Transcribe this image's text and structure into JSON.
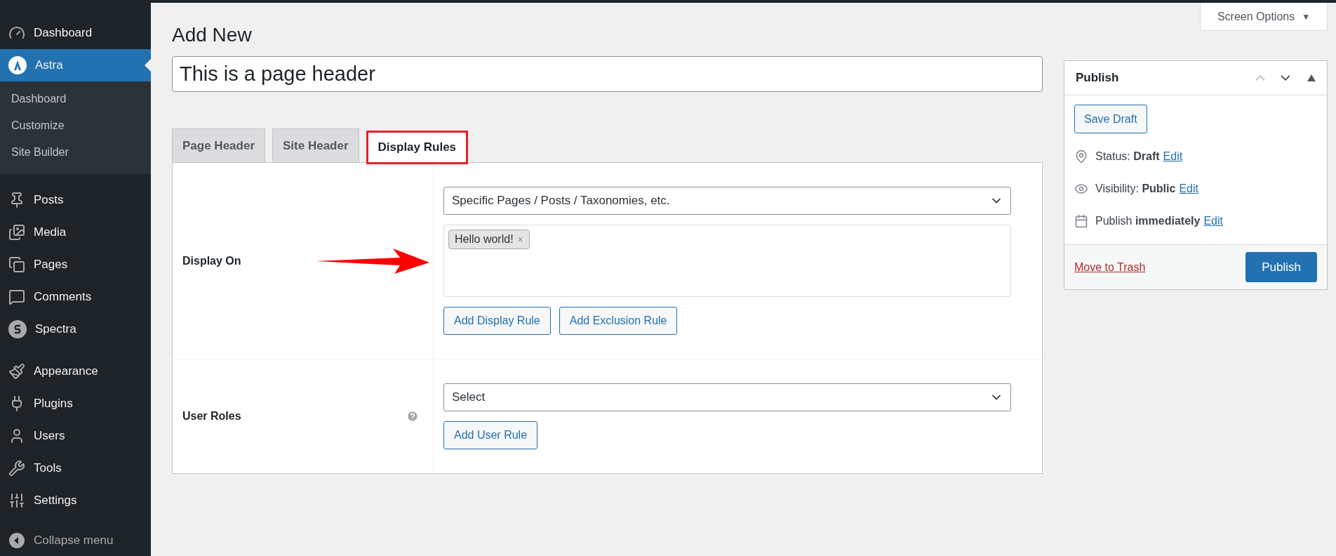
{
  "sidebar": {
    "groups": [
      {
        "items": [
          {
            "label": "Dashboard",
            "selected": false
          },
          {
            "label": "Astra",
            "selected": true,
            "expanded": true,
            "children": [
              {
                "label": "Dashboard"
              },
              {
                "label": "Customize"
              },
              {
                "label": "Site Builder"
              }
            ]
          }
        ]
      },
      {
        "items": [
          {
            "label": "Posts",
            "selected": false
          },
          {
            "label": "Media",
            "selected": false
          },
          {
            "label": "Pages",
            "selected": false
          },
          {
            "label": "Comments",
            "selected": false
          },
          {
            "label": "Spectra",
            "selected": false
          }
        ]
      },
      {
        "items": [
          {
            "label": "Appearance",
            "selected": false
          },
          {
            "label": "Plugins",
            "selected": false
          },
          {
            "label": "Users",
            "selected": false
          },
          {
            "label": "Tools",
            "selected": false
          },
          {
            "label": "Settings",
            "selected": false
          }
        ]
      }
    ],
    "collapse": "Collapse menu"
  },
  "screen_options": {
    "label": "Screen Options",
    "arrow": "▼"
  },
  "page_title": "Add New",
  "title_field": {
    "value": "This is a page header"
  },
  "tabs": [
    {
      "label": "Page Header",
      "selected": false,
      "highlighted": false
    },
    {
      "label": "Site Header",
      "selected": false,
      "highlighted": false
    },
    {
      "label": "Display Rules",
      "selected": true,
      "highlighted": true
    }
  ],
  "rules": [
    {
      "label": "Display On",
      "select": "Specific Pages / Posts / Taxonomies, etc.",
      "tokens": [
        {
          "label": "Hello world!",
          "remove": "×"
        }
      ],
      "buttons": [
        "Add Display Rule",
        "Add Exclusion Rule"
      ],
      "arrow": true
    },
    {
      "label": "User Roles",
      "select": "Select",
      "buttons": [
        "Add User Rule"
      ],
      "arrow": false
    }
  ],
  "publish": {
    "title": "Publish",
    "save_draft": "Save Draft",
    "rows": [
      {
        "text": "Status: **Draft**",
        "link": "Edit"
      },
      {
        "text": "Visibility: **Public**",
        "link": "Edit"
      },
      {
        "text": "Publish **immediately**",
        "link": "Edit"
      }
    ],
    "trash": "Move to Trash",
    "publish_button": "Publish"
  }
}
